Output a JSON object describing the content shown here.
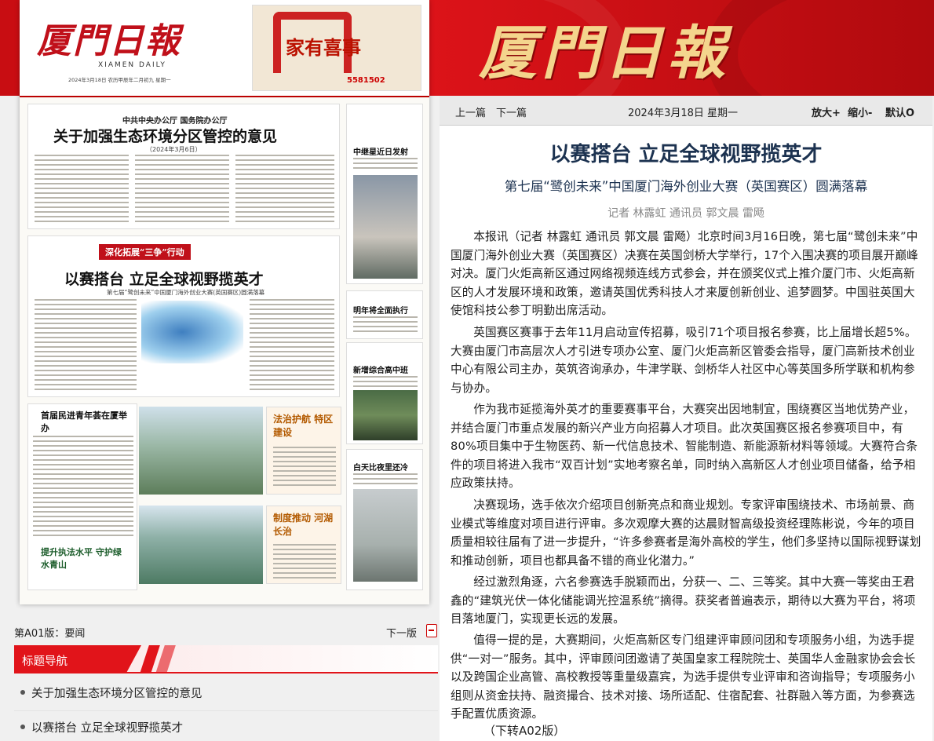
{
  "banner": {
    "logo": "厦門日報"
  },
  "paper": {
    "logo": "厦門日報",
    "sub": "XIAMEN DAILY",
    "date_line": "2024年3月18日  农历甲辰年二月初九  星期一",
    "promo_title": "家有喜事",
    "promo_phone": "5581502",
    "lead_org": "中共中央办公厅  国务院办公厅",
    "lead_title": "关于加强生态环境分区管控的意见",
    "lead_date": "（2024年3月6日）",
    "feature_kicker": "深化拓展“三争”行动",
    "feature_title": "以赛搭台 立足全球视野揽英才",
    "feature_sub": "第七届“鹭创未来”中国厦门海外创业大赛(英国赛区)圆满落幕",
    "side1_title": "中继星近日发射",
    "side2_title": "明年将全面执行",
    "side3_title": "新增综合高中班",
    "side4_title": "白天比夜里还冷",
    "lower1_title": "首届民进青年荟在厦举办",
    "lower2_title": "法治护航 特区建设",
    "lower3_title": "制度推动 河湖长治",
    "lower4_title": "提升执法水平 守护绿水青山"
  },
  "article_bar": {
    "prev": "上一篇",
    "next": "下一篇",
    "date": "2024年3月18日 星期一",
    "zoom_in": "放大+",
    "zoom_out": "缩小-",
    "default": "默认O"
  },
  "article": {
    "title": "以赛搭台 立足全球视野揽英才",
    "subtitle": "第七届“鹭创未来”中国厦门海外创业大赛（英国赛区）圆满落幕",
    "author": "记者 林露虹 通讯员 郭文晨 雷飏",
    "paragraphs": [
      "本报讯（记者 林露虹 通讯员 郭文晨 雷飏）北京时间3月16日晚，第七届“鹭创未来”中国厦门海外创业大赛（英国赛区）决赛在英国剑桥大学举行，17个入围决赛的项目展开巅峰对决。厦门火炬高新区通过网络视频连线方式参会，并在颁奖仪式上推介厦门市、火炬高新区的人才发展环境和政策，邀请英国优秀科技人才来厦创新创业、追梦圆梦。中国驻英国大使馆科技公参丁明勤出席活动。",
      "英国赛区赛事于去年11月启动宣传招募，吸引71个项目报名参赛，比上届增长超5%。大赛由厦门市高层次人才引进专项办公室、厦门火炬高新区管委会指导，厦门高新技术创业中心有限公司主办，英筑咨询承办，牛津学联、剑桥华人社区中心等英国多所学联和机构参与协办。",
      "作为我市延揽海外英才的重要赛事平台，大赛突出因地制宜，围绕赛区当地优势产业，并结合厦门市重点发展的新兴产业方向招募人才项目。此次英国赛区报名参赛项目中，有80%项目集中于生物医药、新一代信息技术、智能制造、新能源新材料等领域。大赛符合条件的项目将进入我市“双百计划”实地考察名单，同时纳入高新区人才创业项目储备，给予相应政策扶持。",
      "决赛现场，选手依次介绍项目创新亮点和商业规划。专家评审围绕技术、市场前景、商业模式等维度对项目进行评审。多次观摩大赛的达晨财智高级投资经理陈彬说，今年的项目质量相较往届有了进一步提升，“许多参赛者是海外高校的学生，他们多坚持以国际视野谋划和推动创新，项目也都具备不错的商业化潜力。”",
      "经过激烈角逐，六名参赛选手脱颖而出，分获一、二、三等奖。其中大赛一等奖由王君鑫的“建筑光伏一体化储能调光控温系统”摘得。获奖者普遍表示，期待以大赛为平台，将项目落地厦门，实现更长远的发展。",
      "值得一提的是，大赛期间，火炬高新区专门组建评审顾问团和专项服务小组，为选手提供“一对一”服务。其中，评审顾问团邀请了英国皇家工程院院士、英国华人金融家协会会长以及跨国企业高管、高校教授等重量级嘉宾，为选手提供专业评审和咨询指导；专项服务小组则从资金扶持、融资撮合、技术对接、场所适配、住宿配套、社群融入等方面，为参赛选手配置优质资源。"
    ],
    "continue": "（下转A02版）"
  },
  "page_panel": {
    "page_label": "第A01版：要闻",
    "next_page": "下一版",
    "nav_title": "标题导航",
    "nav_items": [
      "关于加强生态环境分区管控的意见",
      "以赛搭台 立足全球视野揽英才"
    ]
  },
  "colors": {
    "brand_red": "#e1141a",
    "title_blue": "#1c3250"
  }
}
